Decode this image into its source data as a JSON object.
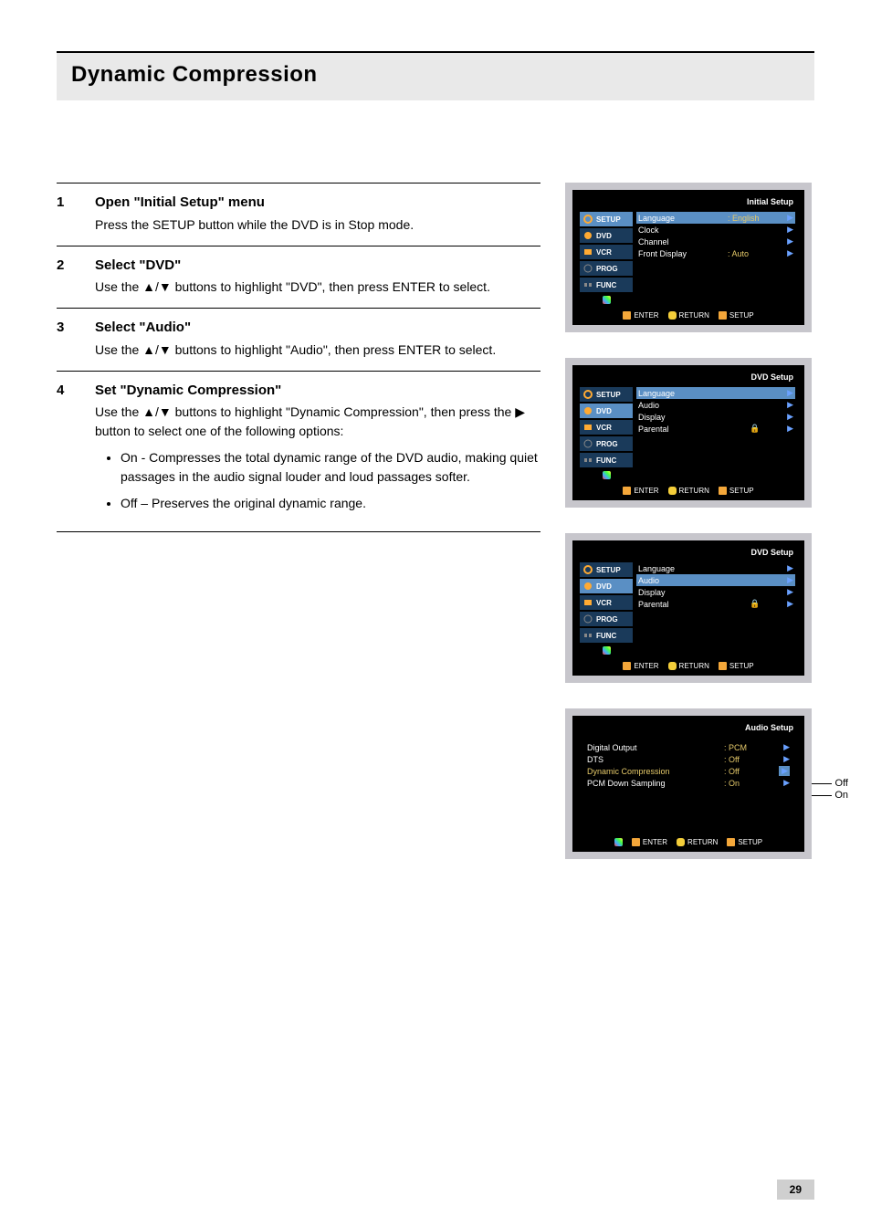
{
  "page_title": "Dynamic Compression",
  "steps": [
    {
      "num": "1",
      "heading": "Open \"Initial Setup\" menu",
      "body": "Press the SETUP button while the DVD is in Stop mode."
    },
    {
      "num": "2",
      "heading": "Select \"DVD\"",
      "body": "Use the ▲/▼ buttons to highlight \"DVD\", then press ENTER to select."
    },
    {
      "num": "3",
      "heading": "Select \"Audio\"",
      "body": "Use the ▲/▼ buttons to highlight \"Audio\", then press ENTER to select."
    },
    {
      "num": "4",
      "heading": "Set \"Dynamic Compression\"",
      "body": "Use the ▲/▼ buttons to highlight \"Dynamic Compression\", then press the ▶ button to select one of the following options:",
      "bullets": [
        "On - Compresses the total dynamic range of the DVD audio, making quiet passages in the audio signal louder and loud passages softer.",
        "Off – Preserves the original dynamic range."
      ]
    }
  ],
  "tabs": {
    "setup": "SETUP",
    "dvd": "DVD",
    "vcr": "VCR",
    "prog": "PROG",
    "func": "FUNC"
  },
  "panel1": {
    "title": "Initial Setup",
    "rows": [
      {
        "label": "Language",
        "value": ": English"
      },
      {
        "label": "Clock",
        "value": ""
      },
      {
        "label": "Channel",
        "value": ""
      },
      {
        "label": "Front Display",
        "value": ": Auto"
      }
    ]
  },
  "panel2": {
    "title": "DVD Setup",
    "rows": [
      {
        "label": "Language",
        "value": ""
      },
      {
        "label": "Audio",
        "value": ""
      },
      {
        "label": "Display",
        "value": ""
      },
      {
        "label": "Parental",
        "value": "",
        "lock": true
      }
    ],
    "highlight_index": 0
  },
  "panel3": {
    "title": "DVD Setup",
    "rows": [
      {
        "label": "Language",
        "value": ""
      },
      {
        "label": "Audio",
        "value": ""
      },
      {
        "label": "Display",
        "value": ""
      },
      {
        "label": "Parental",
        "value": "",
        "lock": true
      }
    ],
    "highlight_index": 1
  },
  "panel4": {
    "title": "Audio Setup",
    "rows": [
      {
        "label": "Digital Output",
        "value": ": PCM"
      },
      {
        "label": "DTS",
        "value": ": Off"
      },
      {
        "label": "Dynamic Compression",
        "value": ": Off",
        "highlight": true
      },
      {
        "label": "PCM Down Sampling",
        "value": ": On"
      }
    ],
    "side_labels": {
      "off": "Off",
      "on": "On"
    }
  },
  "footer": {
    "enter": "ENTER",
    "return": "RETURN",
    "setup": "SETUP"
  },
  "page_number": "29"
}
